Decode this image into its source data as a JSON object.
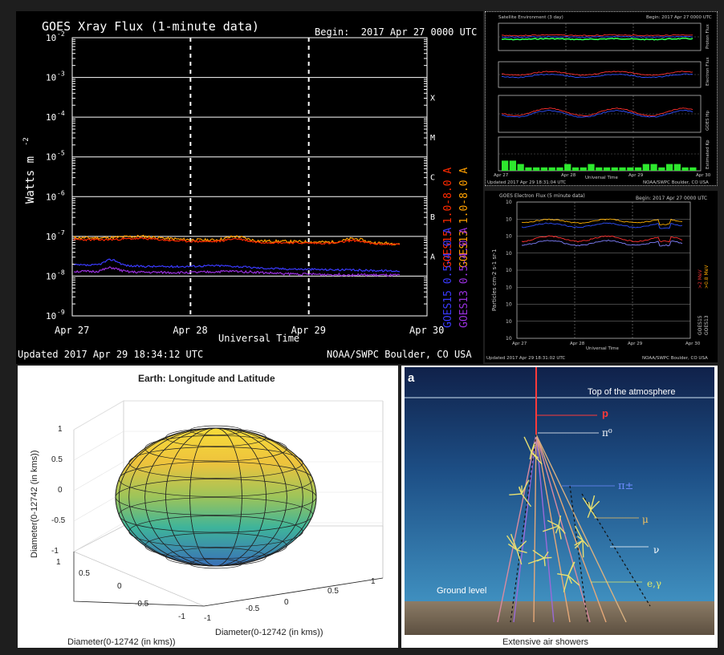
{
  "xray": {
    "title": "GOES Xray Flux (1-minute data)",
    "begin": "Begin:  2017 Apr 27 0000 UTC",
    "ylabel": "Watts m",
    "ylabel_sup": "-2",
    "xlabel": "Universal Time",
    "x_ticks": [
      "Apr 27",
      "Apr 28",
      "Apr 29",
      "Apr 30"
    ],
    "y_ticks": [
      "10",
      "10",
      "10",
      "10",
      "10",
      "10",
      "10",
      "10"
    ],
    "y_exps": [
      "-2",
      "-3",
      "-4",
      "-5",
      "-6",
      "-7",
      "-8",
      "-9"
    ],
    "classes": [
      "X",
      "M",
      "C",
      "B",
      "A"
    ],
    "legend": {
      "g15_long": "GOES15 1.0-8.0 A",
      "g13_long": "GOES13 1.0-8.0 A",
      "g15_short": "GOES15 0.5-4.0 A",
      "g13_short": "GOES13 0.5-4.0 A"
    },
    "updated": "Updated 2017 Apr 29 18:34:12 UTC",
    "credit": "NOAA/SWPC Boulder, CO USA",
    "colors": {
      "g15_long": "#ff2a00",
      "g13_long": "#ffa000",
      "g15_short": "#3a3aff",
      "g13_short": "#9a30e0"
    }
  },
  "satenv": {
    "title": "Satellite Environment (3 day)",
    "begin": "Begin: 2017 Apr 27 0000 UTC",
    "panel_labels": [
      "Proton Flux",
      "Electron Flux",
      "GOES Hp",
      "Estimated Kp"
    ],
    "x_ticks": [
      "Apr 27",
      "Apr 28",
      "Apr 29",
      "Apr 30"
    ],
    "xlabel": "Universal Time",
    "updated": "Updated 2017 Apr 29 18:31:04 UTC",
    "credit": "NOAA/SWPC Boulder, CO USA",
    "kp_values": [
      3,
      3,
      2,
      1,
      1,
      1,
      1,
      1,
      2,
      1,
      1,
      2,
      1,
      1,
      1,
      1,
      1,
      1,
      2,
      2,
      1,
      2,
      2,
      1,
      1
    ]
  },
  "electron": {
    "title": "GOES Electron Flux (5 minute data)",
    "begin": "Begin: 2017 Apr 27 0000 UTC",
    "ylabel": "Particles cm-2 s-1 sr-1",
    "legend": [
      "GOES15",
      "GOES13"
    ],
    "energy_labels": [
      ">2 MeV",
      ">0.8 MeV"
    ],
    "x_ticks": [
      "Apr 27",
      "Apr 28",
      "Apr 29",
      "Apr 30"
    ],
    "xlabel": "Universal Time",
    "updated": "Updated 2017 Apr 29 18:31:02 UTC",
    "credit": "NOAA/SWPC Boulder, CO USA"
  },
  "earth": {
    "title": "Earth: Longitude and Latitude",
    "zlabel": "Diameter(0-12742 (in kms))",
    "xlabel": "Diameter(0-12742 (in kms))",
    "ylabel": "Diameter(0-12742 (in kms))",
    "z_ticks": [
      "1",
      "0.5",
      "0",
      "-0.5",
      "-1"
    ],
    "y_ticks": [
      "1",
      "0.5",
      "0",
      "-0.5",
      "-1"
    ],
    "x_ticks": [
      "-1",
      "-0.5",
      "0",
      "0.5",
      "1"
    ]
  },
  "shower": {
    "panel_letter": "a",
    "top_label": "Top of the atmosphere",
    "ground_label": "Ground level",
    "bottom_label": "Extensive air showers",
    "particles": [
      "p",
      "π⁰",
      "π±",
      "μ",
      "ν",
      "e,γ"
    ]
  }
}
